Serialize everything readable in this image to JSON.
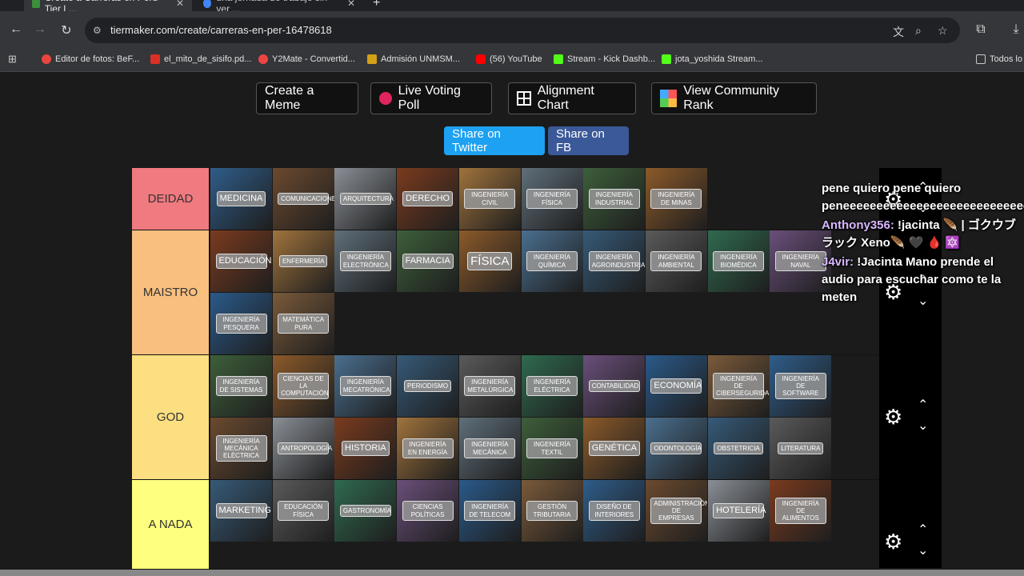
{
  "browser": {
    "tabs": [
      {
        "title": "Create a Carreras en Perú Tier L...",
        "active": true
      },
      {
        "title": "una jornada de trabajo sin ver ...",
        "active": false
      }
    ],
    "url": "tiermaker.com/create/carreras-en-per-16478618",
    "bookmarks": [
      "Editor de fotos: BeF...",
      "el_mito_de_sisifo.pd...",
      "Y2Mate - Convertid...",
      "Admisión UNMSM...",
      "(56) YouTube",
      "Stream - Kick Dashb...",
      "jota_yoshida Stream...",
      "Todos lo"
    ]
  },
  "toolbar": {
    "create_meme": "Create a Meme",
    "live_voting": "Live Voting Poll",
    "alignment": "Alignment Chart",
    "community": "View Community Rank",
    "share_twitter": "Share on Twitter",
    "share_fb": "Share on FB"
  },
  "tiers": [
    {
      "label": "DEIDAD",
      "color": "#ef7a7f",
      "items": [
        "MEDICINA",
        "COMUNICACIONES",
        "ARQUITECTURA",
        "DERECHO",
        "INGENIERÍA CIVIL",
        "INGENIERÍA FÍSICA",
        "INGENIERÍA INDUSTRIAL",
        "INGENIERÍA DE MINAS"
      ]
    },
    {
      "label": "MAISTRO",
      "color": "#f8bf7f",
      "items": [
        "EDUCACIÓN",
        "ENFERMERÍA",
        "INGENIERÍA ELECTRÓNICA",
        "FARMACIA",
        "FÍSICA",
        "INGENIERÍA QUÍMICA",
        "INGENIERÍA AGROINDUSTRIAL",
        "INGENIERÍA AMBIENTAL",
        "INGENIERÍA BIOMÉDICA",
        "INGENIERÍA NAVAL",
        "INGENIERÍA PESQUERA",
        "MATEMÁTICA PURA"
      ]
    },
    {
      "label": "GOD",
      "color": "#fbdf80",
      "items": [
        "INGENIERÍA DE SISTEMAS",
        "CIENCIAS DE LA COMPUTACIÓN",
        "INGENIERÍA MECATRÓNICA",
        "PERIODISMO",
        "INGENIERÍA METALÚRGICA",
        "INGENIERÍA ELÉCTRICA",
        "CONTABILIDAD",
        "ECONOMÍA",
        "INGENIERÍA DE CIBERSEGURIDAD",
        "INGENIERÍA DE SOFTWARE",
        "INGENIERÍA MECÁNICA ELÉCTRICA",
        "ANTROPOLOGÍA",
        "HISTORIA",
        "INGENIERÍA EN ENERGÍA",
        "INGENIERÍA MECÁNICA",
        "INGENIERÍA TEXTIL",
        "GENÉTICA",
        "ODONTOLOGÍA",
        "OBSTETRICIA",
        "LITERATURA"
      ]
    },
    {
      "label": "A NADA",
      "color": "#fefe7f",
      "items": [
        "MARKETING",
        "EDUCACIÓN FÍSICA",
        "GASTRONOMÍA",
        "CIENCIAS POLÍTICAS",
        "INGENIERÍA DE TELECOM",
        "GESTIÓN TRIBUTARIA",
        "DISEÑO DE INTERIORES",
        "ADMINISTRACIÓN DE EMPRESAS",
        "HOTELERÍA",
        "INGENIERÍA DE ALIMENTOS"
      ]
    }
  ],
  "chat": [
    {
      "user": "",
      "text": "pene quiero pene quiero peneeeeeeeeeeeeeeeeeeeeeeeeeeeeeeeee"
    },
    {
      "user": "Anthony356:",
      "text": "!jacinta 🪶 | ゴクウブラック Xeno🪶 🖤 🩸 🔯"
    },
    {
      "user": "J4vir:",
      "text": "!Jacinta Mano prende el audio para escuchar como te la meten"
    }
  ]
}
